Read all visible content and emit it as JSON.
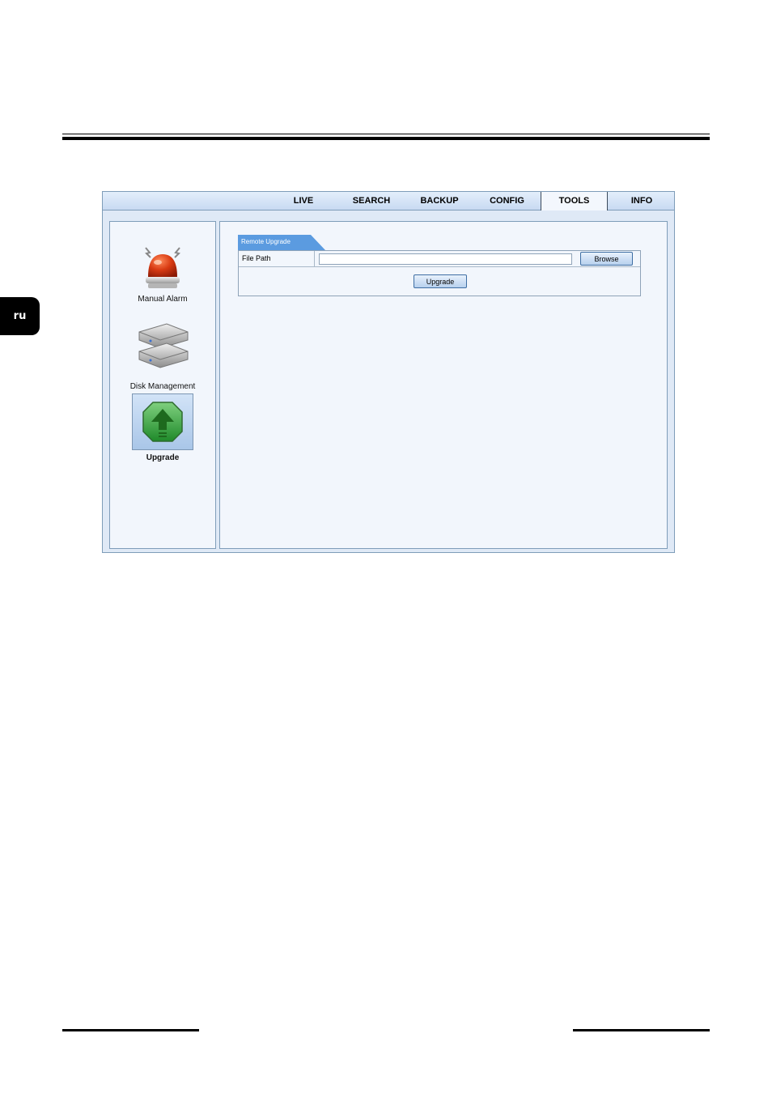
{
  "language_tab": "ru",
  "nav": {
    "tabs": [
      {
        "label": "LIVE"
      },
      {
        "label": "SEARCH"
      },
      {
        "label": "BACKUP"
      },
      {
        "label": "CONFIG"
      },
      {
        "label": "TOOLS"
      },
      {
        "label": "INFO"
      }
    ],
    "active": "TOOLS"
  },
  "sidebar": {
    "items": [
      {
        "label": "Manual Alarm",
        "icon": "alarm-siren-icon"
      },
      {
        "label": "Disk Management",
        "icon": "hard-disk-icon"
      },
      {
        "label": "Upgrade",
        "icon": "upgrade-arrow-icon",
        "selected": true
      }
    ]
  },
  "remote_upgrade": {
    "section_title": "Remote Upgrade",
    "file_path_label": "File Path",
    "file_path_value": "",
    "browse_label": "Browse",
    "upgrade_label": "Upgrade"
  },
  "colors": {
    "accent_tab": "#5b9be0",
    "nav_bg": "#c8daf2",
    "panel_bg": "#f2f6fc"
  }
}
